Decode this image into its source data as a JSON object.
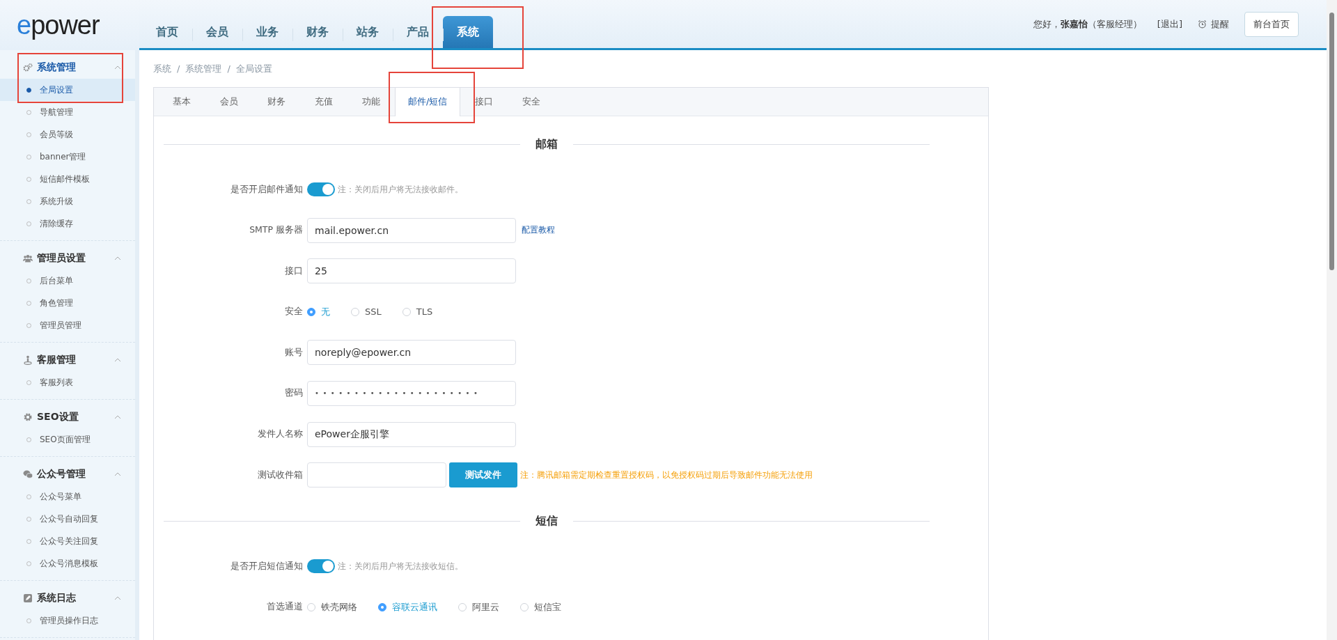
{
  "logo": {
    "text": "epower"
  },
  "top_nav": [
    {
      "label": "首页",
      "selected": false,
      "highlighted": false
    },
    {
      "label": "会员",
      "selected": false,
      "highlighted": false
    },
    {
      "label": "业务",
      "selected": false,
      "highlighted": false
    },
    {
      "label": "财务",
      "selected": false,
      "highlighted": false
    },
    {
      "label": "站务",
      "selected": false,
      "highlighted": false
    },
    {
      "label": "产品",
      "selected": false,
      "highlighted": false
    },
    {
      "label": "系统",
      "selected": true,
      "highlighted": true
    }
  ],
  "user": {
    "greeting": "您好，",
    "name": "张嘉怡",
    "role": "（客服经理）",
    "logout": "[退出]",
    "reminder": "提醒",
    "home_button": "前台首页"
  },
  "sidebar": {
    "groups": [
      {
        "title": "系统管理",
        "selected": true,
        "expanded": true,
        "highlighted": true,
        "items": [
          {
            "label": "全局设置",
            "selected": true
          },
          {
            "label": "导航管理",
            "selected": false
          },
          {
            "label": "会员等级",
            "selected": false
          },
          {
            "label": "banner管理",
            "selected": false
          },
          {
            "label": "短信邮件模板",
            "selected": false
          },
          {
            "label": "系统升级",
            "selected": false
          },
          {
            "label": "清除缓存",
            "selected": false
          }
        ]
      },
      {
        "title": "管理员设置",
        "selected": false,
        "expanded": true,
        "highlighted": false,
        "items": [
          {
            "label": "后台菜单",
            "selected": false
          },
          {
            "label": "角色管理",
            "selected": false
          },
          {
            "label": "管理员管理",
            "selected": false
          }
        ]
      },
      {
        "title": "客服管理",
        "selected": false,
        "expanded": true,
        "highlighted": false,
        "items": [
          {
            "label": "客服列表",
            "selected": false
          }
        ]
      },
      {
        "title": "SEO设置",
        "selected": false,
        "expanded": true,
        "highlighted": false,
        "items": [
          {
            "label": "SEO页面管理",
            "selected": false
          }
        ]
      },
      {
        "title": "公众号管理",
        "selected": false,
        "expanded": true,
        "highlighted": false,
        "items": [
          {
            "label": "公众号菜单",
            "selected": false
          },
          {
            "label": "公众号自动回复",
            "selected": false
          },
          {
            "label": "公众号关注回复",
            "selected": false
          },
          {
            "label": "公众号消息模板",
            "selected": false
          }
        ]
      },
      {
        "title": "系统日志",
        "selected": false,
        "expanded": true,
        "highlighted": false,
        "items": [
          {
            "label": "管理员操作日志",
            "selected": false
          }
        ]
      }
    ]
  },
  "breadcrumb": [
    "系统",
    "系统管理",
    "全局设置"
  ],
  "breadcrumb_separator": "/",
  "tabs": [
    {
      "label": "基本",
      "selected": false,
      "highlighted": false
    },
    {
      "label": "会员",
      "selected": false,
      "highlighted": false
    },
    {
      "label": "财务",
      "selected": false,
      "highlighted": false
    },
    {
      "label": "充值",
      "selected": false,
      "highlighted": false
    },
    {
      "label": "功能",
      "selected": false,
      "highlighted": false
    },
    {
      "label": "邮件/短信",
      "selected": true,
      "highlighted": true
    },
    {
      "label": "接口",
      "selected": false,
      "highlighted": false
    },
    {
      "label": "安全",
      "selected": false,
      "highlighted": false
    }
  ],
  "sections": [
    {
      "title": "邮箱",
      "rows": [
        {
          "kind": "switch",
          "label": "是否开启邮件通知",
          "on": true,
          "note": "注：关闭后用户将无法接收邮件。"
        },
        {
          "kind": "input",
          "label": "SMTP 服务器",
          "value": "mail.epower.cn",
          "link": "配置教程"
        },
        {
          "kind": "input",
          "label": "接口",
          "value": "25"
        },
        {
          "kind": "radio",
          "label": "安全",
          "options": [
            {
              "label": "无",
              "selected": true
            },
            {
              "label": "SSL",
              "selected": false
            },
            {
              "label": "TLS",
              "selected": false
            }
          ]
        },
        {
          "kind": "input",
          "label": "账号",
          "value": "noreply@epower.cn"
        },
        {
          "kind": "password",
          "label": "密码",
          "value": "•••••••••••••••••••••"
        },
        {
          "kind": "input",
          "label": "发件人名称",
          "value": "ePower企服引擎"
        },
        {
          "kind": "test",
          "label": "测试收件箱",
          "button": "测试发件",
          "warning": "注：腾讯邮箱需定期检查重置授权码，以免授权码过期后导致邮件功能无法使用"
        }
      ]
    },
    {
      "title": "短信",
      "rows": [
        {
          "kind": "switch",
          "label": "是否开启短信通知",
          "on": true,
          "note": "注：关闭后用户将无法接收短信。"
        },
        {
          "kind": "radio",
          "label": "首选通道",
          "options": [
            {
              "label": "铁壳网络",
              "selected": false
            },
            {
              "label": "容联云通讯",
              "selected": true
            },
            {
              "label": "阿里云",
              "selected": false
            },
            {
              "label": "短信宝",
              "selected": false
            }
          ]
        }
      ]
    }
  ]
}
